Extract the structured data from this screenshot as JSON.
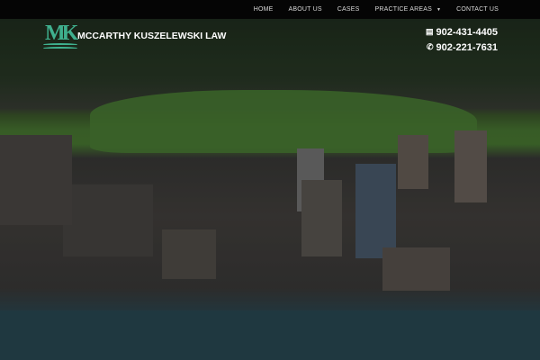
{
  "nav": {
    "items": [
      {
        "label": "HOME"
      },
      {
        "label": "ABOUT US"
      },
      {
        "label": "CASES"
      },
      {
        "label": "PRACTICE AREAS",
        "has_dropdown": true
      },
      {
        "label": "CONTACT US"
      }
    ]
  },
  "brand": {
    "name": "MCCARTHY KUSZELEWSKI LAW",
    "monogram": "MK",
    "color": "#3fb08e"
  },
  "contact": {
    "fax": "902-431-4405",
    "phone": "902-221-7631",
    "fax_icon": "fax-icon",
    "phone_icon": "phone-icon"
  }
}
